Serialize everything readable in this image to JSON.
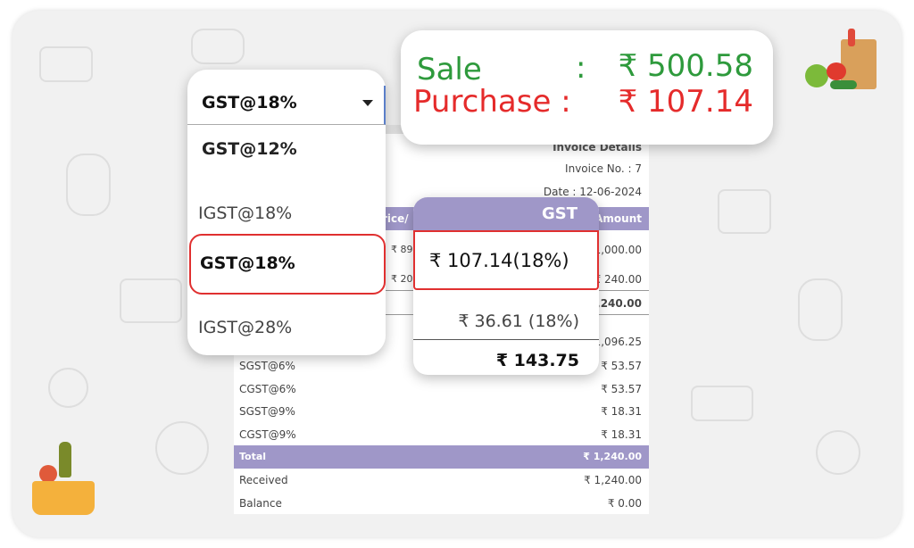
{
  "colors": {
    "sale": "#2e9a3c",
    "purchase": "#e52b2b",
    "purple": "#9f97c8",
    "highlight": "#e03030"
  },
  "summary": {
    "sale_label": "Sale",
    "sale_colon": ":",
    "sale_value": "₹ 500.58",
    "purchase_label": "Purchase :",
    "purchase_value": "₹ 107.14"
  },
  "dropdown": {
    "selected": "GST@18%",
    "options": [
      "GST@12%",
      "IGST@18%",
      "GST@18%",
      "IGST@28%"
    ],
    "highlighted_index": 2
  },
  "invoice": {
    "title": "Invoice Details",
    "invoice_no": "Invoice No. : 7",
    "date": "Date : 12-06-2024",
    "col_price": "rice/",
    "col_amount": "Amount",
    "items": [
      {
        "price": "₹ 89",
        "amount": "1,000.00"
      },
      {
        "price": "₹ 20",
        "amount": "₹ 240.00"
      }
    ],
    "items_total": "1,240.00",
    "subtotal": "1,096.25",
    "taxes": [
      {
        "label": "SGST@6%",
        "value": "₹ 53.57"
      },
      {
        "label": "CGST@6%",
        "value": "₹ 53.57"
      },
      {
        "label": "SGST@9%",
        "value": "₹ 18.31"
      },
      {
        "label": "CGST@9%",
        "value": "₹ 18.31"
      }
    ],
    "total_label": "Total",
    "total_value": "₹ 1,240.00",
    "received_label": "Received",
    "received_value": "₹ 1,240.00",
    "balance_label": "Balance",
    "balance_value": "₹ 0.00"
  },
  "gst_popup": {
    "header": "GST",
    "row1": "₹  107.14(18%)",
    "row2": "₹ 36.61 (18%)",
    "total": "₹ 143.75"
  }
}
